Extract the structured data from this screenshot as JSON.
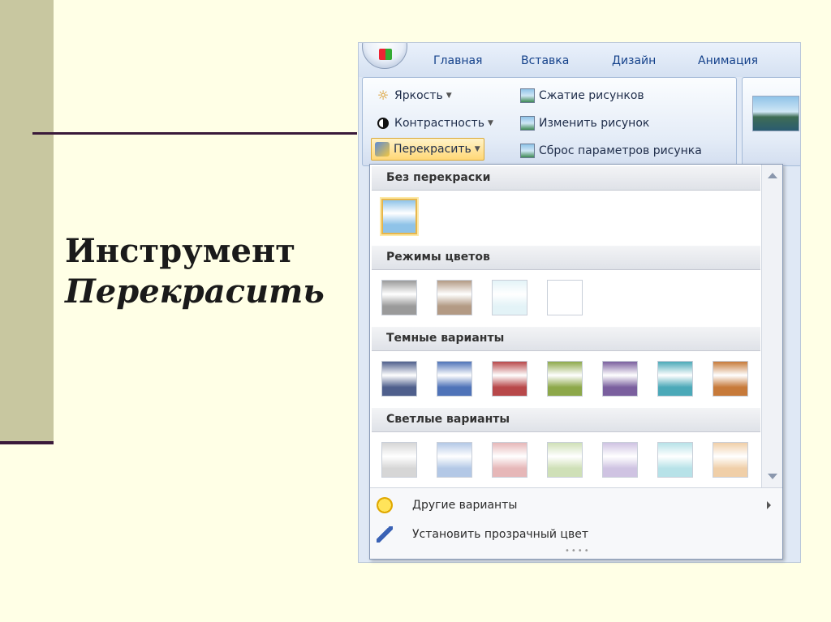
{
  "slide": {
    "title_line1": "Инструмент",
    "title_line2": "Перекрасить"
  },
  "ribbon_tabs": [
    "Главная",
    "Вставка",
    "Дизайн",
    "Анимация"
  ],
  "picture_tools": {
    "brightness": "Яркость",
    "contrast": "Контрастность",
    "recolor": "Перекрасить",
    "compress": "Сжатие рисунков",
    "change_picture": "Изменить рисунок",
    "reset_picture": "Сброс параметров рисунка"
  },
  "gallery": {
    "sections": [
      "Без перекраски",
      "Режимы цветов",
      "Темные варианты",
      "Светлые варианты"
    ],
    "no_recolor": [
      "#8fc3e8"
    ],
    "color_modes": [
      "#9a9a9a",
      "#b39a84",
      "#e3f3f7",
      "#ffffff"
    ],
    "dark_variants": [
      "#4f5f8c",
      "#4f73b8",
      "#b8484a",
      "#8da84a",
      "#7a5f9e",
      "#4ba9b8",
      "#c77a3a"
    ],
    "light_variants": [
      "#d6d6d6",
      "#b3c8e6",
      "#e6b7b8",
      "#cfe0b7",
      "#cfc3e2",
      "#b7e2e8",
      "#f0cfa8"
    ]
  },
  "menu": {
    "more_variants": "Другие варианты",
    "set_transparent": "Установить прозрачный цвет"
  },
  "colors": {
    "slide_bg": "#ffffe6",
    "left_bar": "#c8c7a0",
    "accent_line": "#3a1a3a",
    "ribbon_text": "#15428b"
  }
}
